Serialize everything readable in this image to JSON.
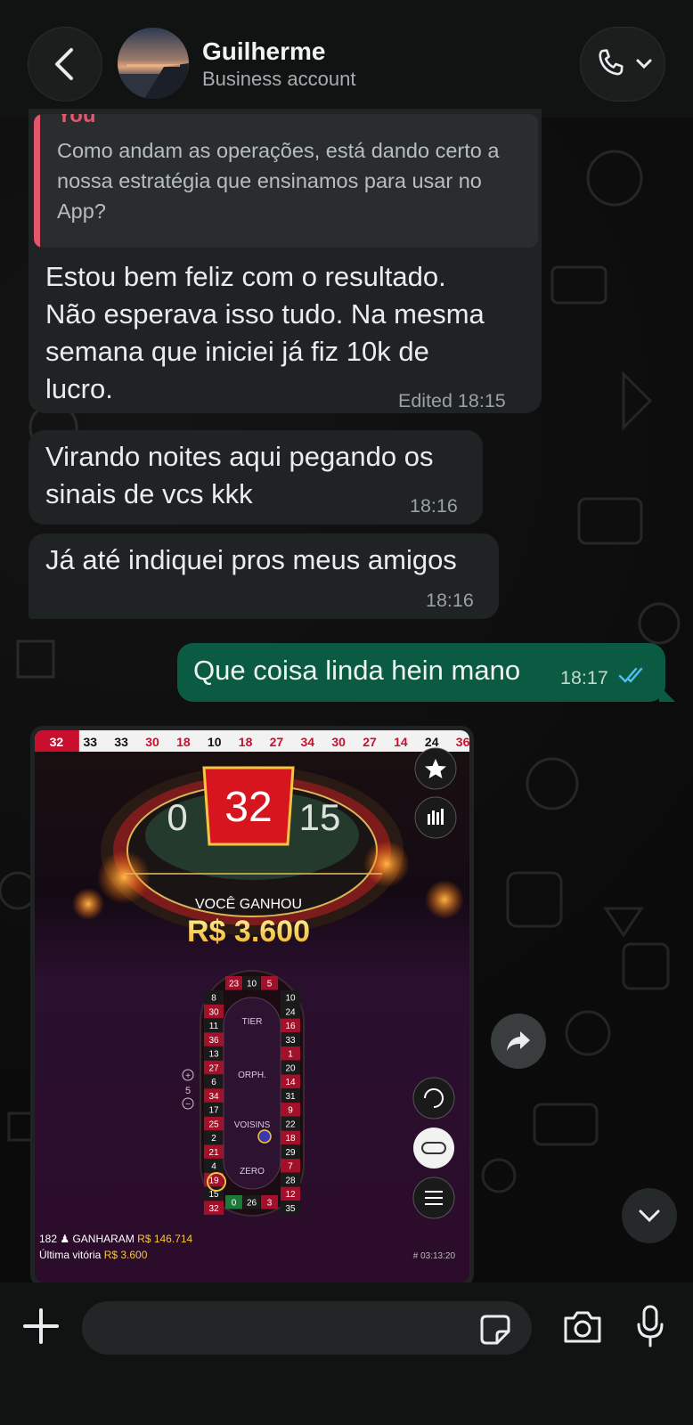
{
  "header": {
    "contact_name": "Guilherme",
    "contact_subtitle": "Business account"
  },
  "messages": {
    "quoted": {
      "author": "You",
      "text": "Como andam as operações, está dando certo a nossa estratégia que ensinamos para usar no App?"
    },
    "m1": {
      "lines": [
        "Estou bem feliz com o resultado.",
        "Não esperava isso tudo. Na mesma",
        "semana que iniciei já fiz 10k de",
        "lucro."
      ],
      "meta": "Edited 18:15"
    },
    "m2": {
      "lines": [
        "Virando noites aqui pegando os",
        "sinais de vcs kkk"
      ],
      "time": "18:16"
    },
    "m3": {
      "text": "Já até indiquei pros meus amigos",
      "time": "18:16"
    },
    "m4": {
      "text": "Que coisa linda hein mano",
      "time": "18:17",
      "status": "read"
    }
  },
  "media": {
    "history": [
      "32",
      "33",
      "33",
      "30",
      "18",
      "10",
      "18",
      "27",
      "34",
      "30",
      "27",
      "14",
      "24",
      "36"
    ],
    "history_colors": [
      "red",
      "black",
      "black",
      "red",
      "red",
      "black",
      "red",
      "red",
      "red",
      "red",
      "red",
      "red",
      "black",
      "red"
    ],
    "result_left": "0",
    "result_main": "32",
    "result_right": "15",
    "win_label": "VOCÊ GANHOU",
    "win_amount": "R$ 3.600",
    "race_left": [
      "8",
      "30",
      "11",
      "36",
      "13",
      "27",
      "6",
      "34",
      "17",
      "25",
      "2",
      "21",
      "4",
      "19",
      "15",
      "32"
    ],
    "race_right": [
      "10",
      "24",
      "16",
      "33",
      "1",
      "20",
      "14",
      "31",
      "9",
      "22",
      "18",
      "29",
      "7",
      "28",
      "12",
      "35"
    ],
    "race_top": [
      "23",
      "10",
      "5"
    ],
    "race_bottom": [
      "0",
      "26",
      "3"
    ],
    "sections": [
      "TIER",
      "ORPH.",
      "VOISINS",
      "ZERO"
    ],
    "zoom_value": "5",
    "players": "182",
    "won_label": "GANHARAM",
    "won_amount": "R$ 146.714",
    "last_win_label": "Última vitória",
    "last_win_amount": "R$ 3.600",
    "round_id": "# 03:13:20"
  },
  "composer": {
    "placeholder": ""
  },
  "colors": {
    "incoming_bubble": "#202323",
    "outgoing_bubble": "#0b5b43",
    "quote_accent": "#e2566e",
    "read_ticks": "#53bdeb",
    "roulette_red": "#c8102e",
    "gold": "#f5c542"
  },
  "icons": [
    "back-icon",
    "phone-icon",
    "chevron-down-icon",
    "forward-icon",
    "plus-icon",
    "sticker-icon",
    "camera-icon",
    "mic-icon",
    "star-icon",
    "stats-icon"
  ]
}
